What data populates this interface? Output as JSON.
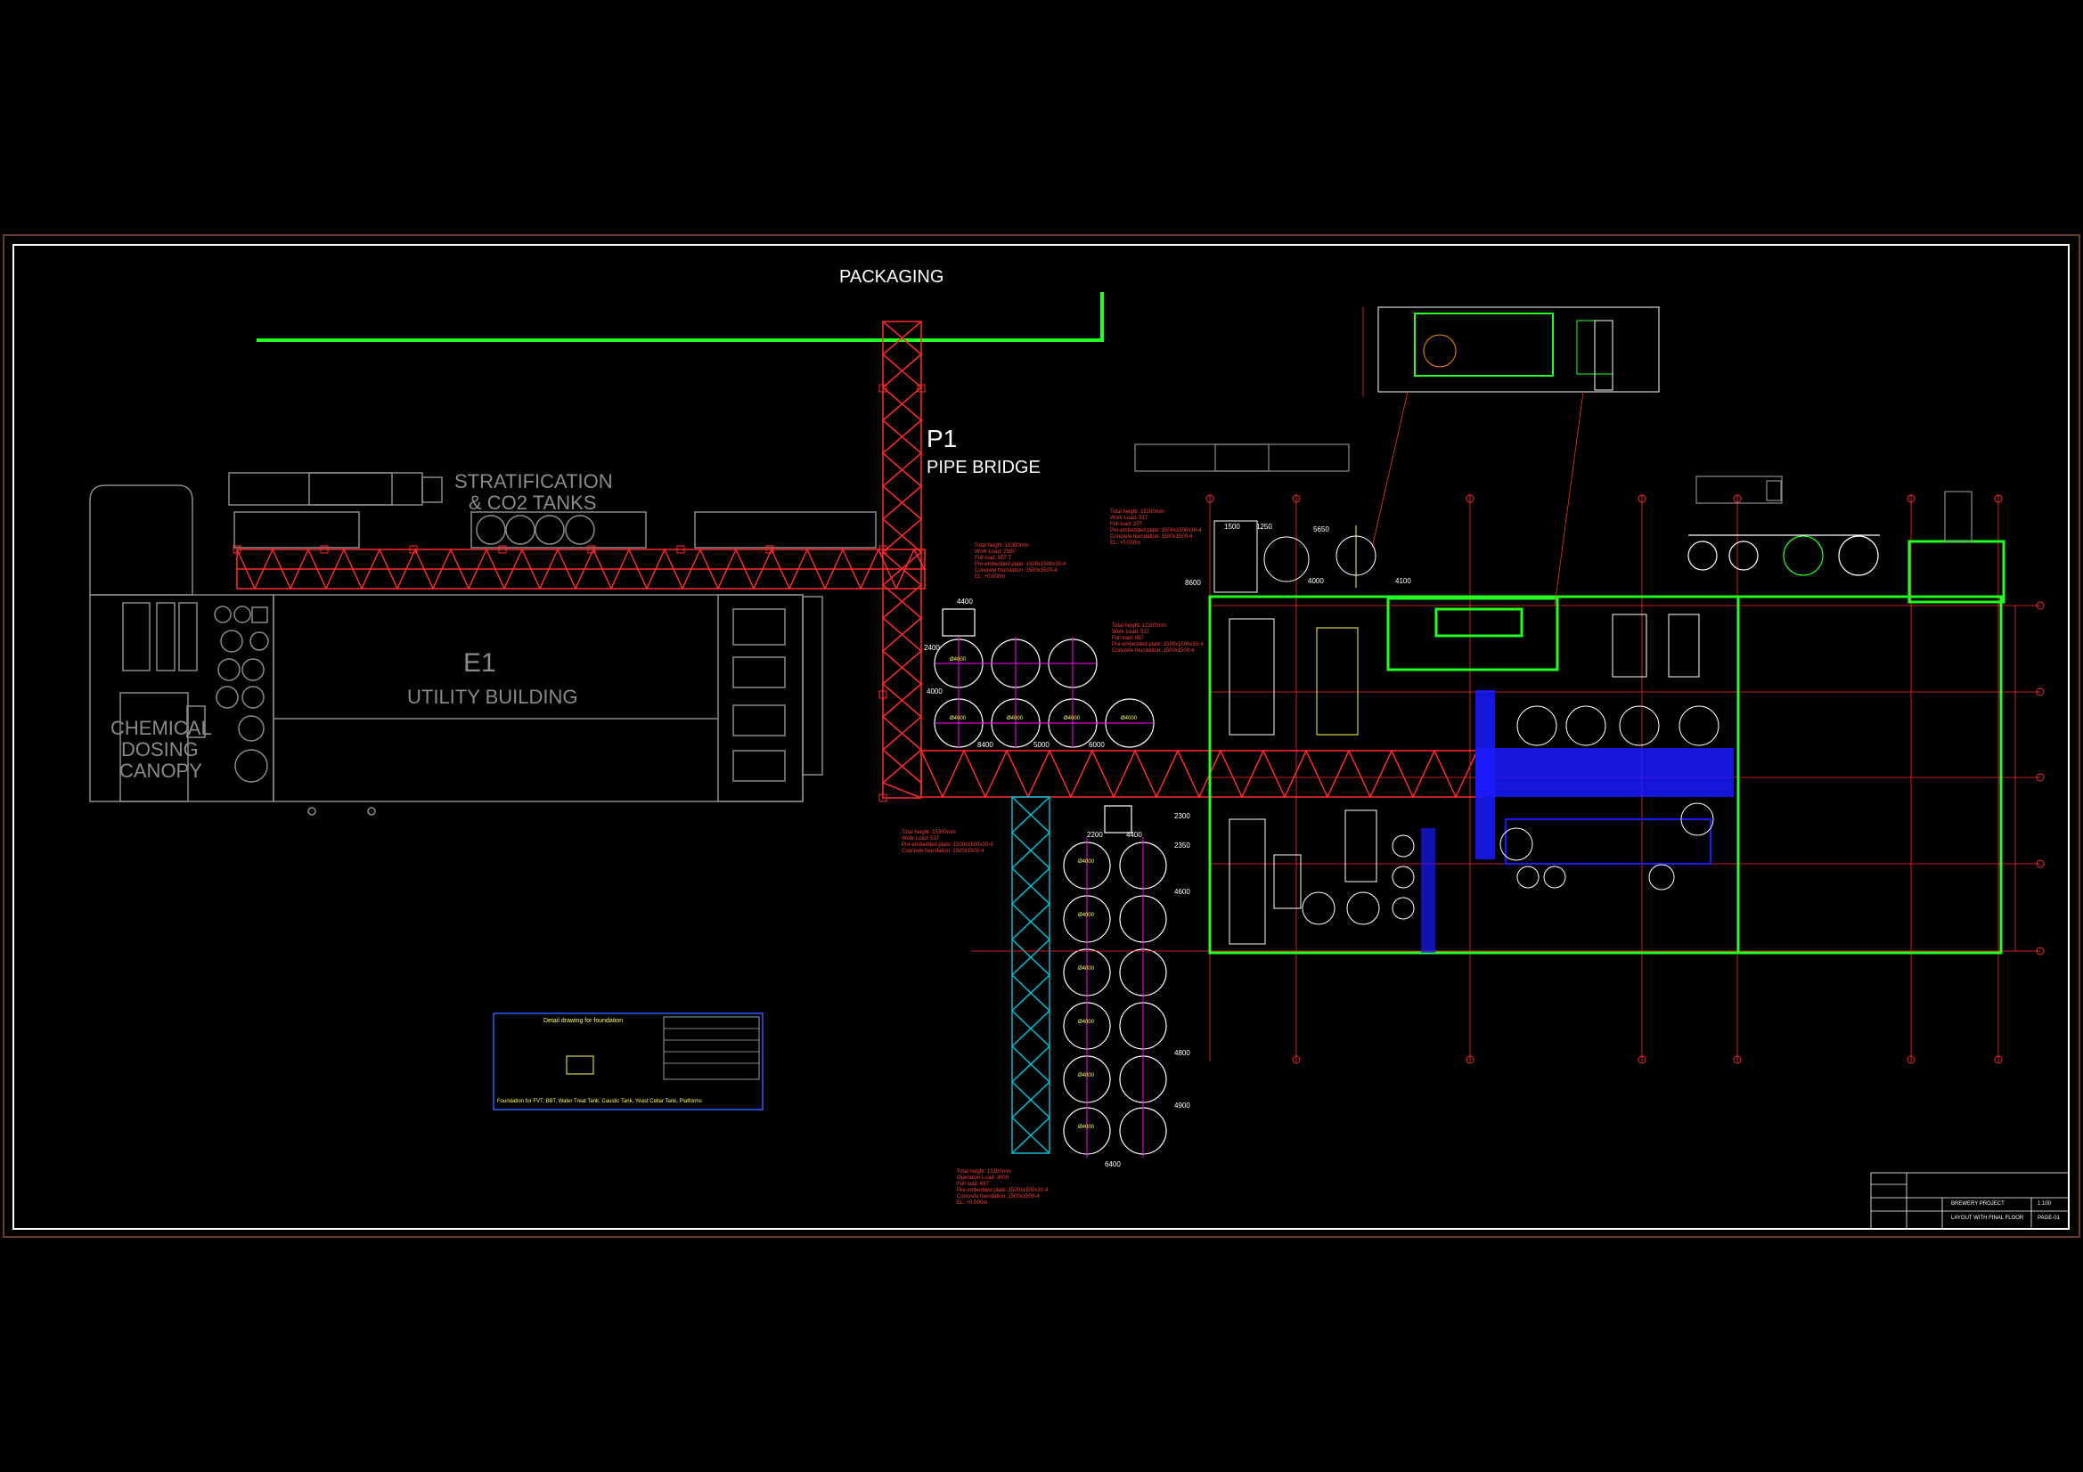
{
  "labels": {
    "packaging": "PACKAGING",
    "p1": "P1",
    "pipe_bridge": "PIPE BRIDGE",
    "stratification_line1": "STRATIFICATION",
    "stratification_line2": "& CO2 TANKS",
    "e1": "E1",
    "utility_building": "UTILITY BUILDING",
    "chemical_line1": "CHEMICAL",
    "chemical_line2": "DOSING",
    "chemical_line3": "CANOPY"
  },
  "dimensions": {
    "d4400_top": "4400",
    "d2400": "2400",
    "d8400": "8400",
    "d5000": "5000",
    "d6000": "6000",
    "d4400_bot": "4400",
    "d2200": "2200",
    "d2300": "2300",
    "d2350": "2350",
    "d4600": "4600",
    "d4800": "4800",
    "d4900": "4900",
    "d6400": "6400",
    "d1500": "1500",
    "d1250": "1250",
    "d5650": "5650",
    "d4000": "4000",
    "d4100": "4100",
    "d8600": "8600",
    "d4000b": "4000"
  },
  "tank_labels": {
    "row1": [
      "Ø4000",
      "Ø4000",
      "Ø4000",
      "Ø4000",
      "Ø4000"
    ],
    "col": [
      "Ø4000",
      "Ø4000",
      "Ø4000",
      "Ø4000",
      "Ø4000",
      "Ø4000"
    ]
  },
  "notes": {
    "fv_note": "Total height: 15300mm\nWork Load: 2500\nFull load: 657 T\nPre-embedded plate: 1500x1500x30-4\nConcrete foundation: 1500x1500-4\nEL: +0.000m",
    "bbt_note": "Total height: 12100mm\nWork Load: 517\nFull load: 657\nPre-embedded plate: 1500x1500x30-4\nConcrete foundation: 1500x1500-4",
    "col_note": "Total height: 15300mm\nWork Load: 517\nPre-embedded plate: 1500x1500x30-4\nConcrete foundation: 1500x1500-4",
    "bottom_note": "Total height: 15100mm\nOperation Load: 3000\nFull load: 657\nPre-embedded plate: 1500x1500x30-4\nConcrete foundation: 1500x1500-4\nEL: +0.000m",
    "top_note": "Total height: 15200mm\nWork Load: 517\nFull load: 257\nPre-embedded plate: 1500x1500x30-4\nConcrete foundation: 1500x1500-4\nEL: +0.000m"
  },
  "detail_box": {
    "title": "Detail drawing for foundation",
    "footer": "Foundation for FVT, BBT, Water Treat Tank, Caustic Tank, Yeast Cellar Tank, Platforms"
  },
  "title_block": {
    "project": "BREWERY PROJECT",
    "drawing": "LAYOUT WITH FINAL FLOOR",
    "number": "PAGE-01",
    "scale": "1:100"
  },
  "colors": {
    "background": "#000000",
    "frame": "#ffffff",
    "pipe_bridge": "#ff2a2a",
    "green_wall": "#22ff22",
    "grey_building": "#8a8a8a",
    "cyan_structure": "#00bcd4",
    "blue_fill": "#1a1aff",
    "magenta_grid": "#ff00ff"
  }
}
